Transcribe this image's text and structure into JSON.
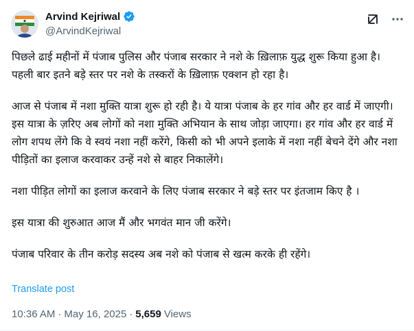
{
  "author": {
    "display_name": "Arvind Kejriwal",
    "handle": "@ArvindKejriwal",
    "verified": true
  },
  "icons": {
    "verified": "verified-badge-icon",
    "grok": "grok-icon",
    "more": "more-options-icon"
  },
  "colors": {
    "accent": "#1d9bf0",
    "text": "#0f1419",
    "muted": "#536471"
  },
  "tweet": {
    "paragraphs": [
      "पिछले ढाई महीनों में पंजाब पुलिस और पंजाब सरकार ने नशे के ख़िलाफ़ युद्ध शुरू किया हुआ है। पहली बार इतने बड़े स्तर पर नशे के तस्करों के ख़िलाफ़ एक्शन हो रहा है।",
      "आज से पंजाब में नशा मुक्ति यात्रा शुरू हो रही है। ये यात्रा पंजाब के हर गांव और हर वार्ड में जाएगी। इस यात्रा के ज़रिए अब लोगों को नशा मुक्ति अभियान के साथ जोड़ा जाएगा। हर गांव और हर वार्ड में लोग शपथ लेंगे कि वे स्वयं नशा नहीं करेंगे, किसी को भी अपने इलाके में नशा नहीं बेचने देंगे और नशा पीड़ितों का इलाज करवाकर उन्हें नशे से बाहर निकालेंगे।",
      "नशा पीड़ित लोगों का इलाज करवाने के लिए पंजाब सरकार ने बड़े स्तर पर इंतजाम किए है ।",
      "इस यात्रा की शुरुआत आज मैं और भगवंत मान जी करेंगे।",
      "पंजाब परिवार के तीन करोड़ सदस्य अब नशे को पंजाब से खत्म करके ही रहेंगे।"
    ],
    "translate_label": "Translate post",
    "time": "10:36 AM",
    "separator": "·",
    "date": "May 16, 2025",
    "views_count": "5,659",
    "views_label": "Views"
  }
}
